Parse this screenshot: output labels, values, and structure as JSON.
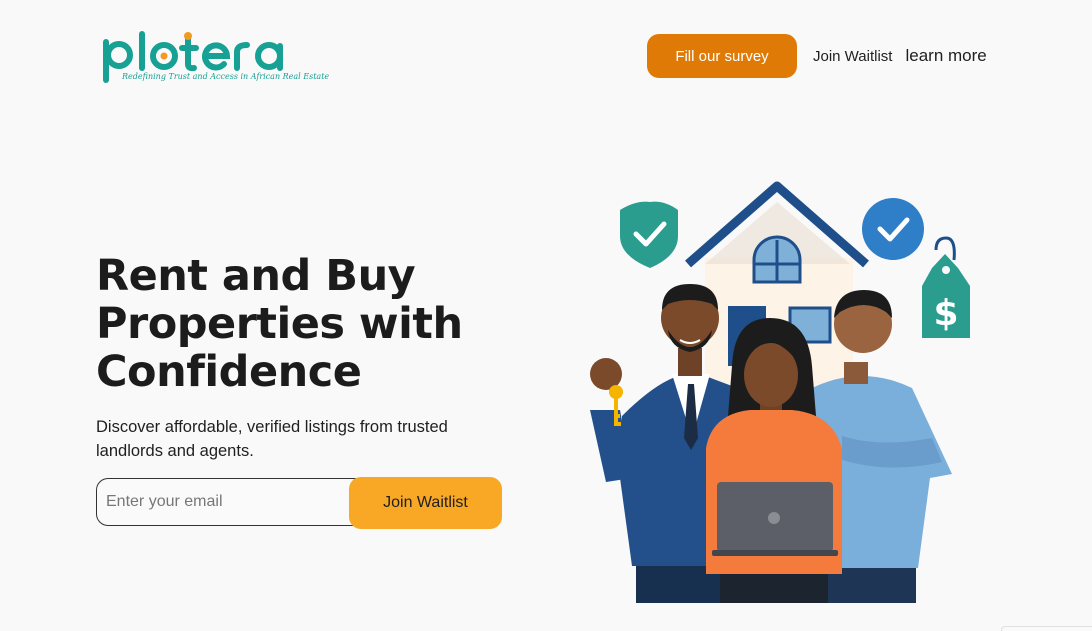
{
  "brand": {
    "name": "plotera",
    "tagline": "Redefining Trust and Access in African Real Estate",
    "primary_color": "#17a094",
    "accent_color": "#f29a1f"
  },
  "nav": {
    "survey_label": "Fill our survey",
    "waitlist_label": "Join Waitlist",
    "learn_label": "learn more"
  },
  "hero": {
    "title_line1": "Rent and Buy",
    "title_line2": "Properties with",
    "title_line3": "Confidence",
    "subtitle": "Discover affordable, verified listings from trusted landlords and agents.",
    "email_placeholder": "Enter your email",
    "join_label": "Join Waitlist"
  },
  "illustration": {
    "icons": [
      "shield-check-icon",
      "check-circle-icon",
      "price-tag-icon",
      "key-icon",
      "house-icon",
      "laptop-icon"
    ],
    "price_symbol": "$"
  },
  "colors": {
    "survey_button": "#e07a07",
    "join_button": "#f9a826",
    "background": "#f9f9f9"
  }
}
